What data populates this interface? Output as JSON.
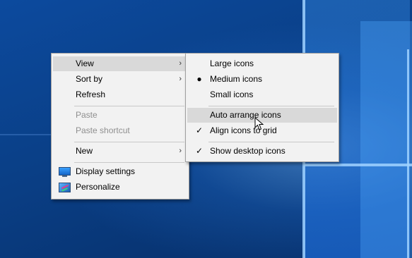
{
  "context_menu": {
    "items": [
      {
        "label": "View",
        "has_submenu": true,
        "highlighted": true,
        "disabled": false
      },
      {
        "label": "Sort by",
        "has_submenu": true,
        "highlighted": false,
        "disabled": false
      },
      {
        "label": "Refresh",
        "has_submenu": false,
        "highlighted": false,
        "disabled": false
      },
      {
        "label": "Paste",
        "has_submenu": false,
        "highlighted": false,
        "disabled": true
      },
      {
        "label": "Paste shortcut",
        "has_submenu": false,
        "highlighted": false,
        "disabled": true
      },
      {
        "label": "New",
        "has_submenu": true,
        "highlighted": false,
        "disabled": false
      },
      {
        "label": "Display settings",
        "icon": "display-settings-icon",
        "disabled": false
      },
      {
        "label": "Personalize",
        "icon": "personalize-icon",
        "disabled": false
      }
    ]
  },
  "view_submenu": {
    "items": [
      {
        "label": "Large icons",
        "mark": ""
      },
      {
        "label": "Medium icons",
        "mark": "●"
      },
      {
        "label": "Small icons",
        "mark": ""
      },
      {
        "label": "Auto arrange icons",
        "mark": "",
        "highlighted": true
      },
      {
        "label": "Align icons to grid",
        "mark": "✓"
      },
      {
        "label": "Show desktop icons",
        "mark": "✓"
      }
    ]
  },
  "glyphs": {
    "submenu_arrow": "›"
  },
  "colors": {
    "menu_bg": "#f2f2f2",
    "highlight": "#d9d9d9",
    "disabled_text": "#8f8f8f",
    "desktop_blue": "#0a3f86"
  }
}
